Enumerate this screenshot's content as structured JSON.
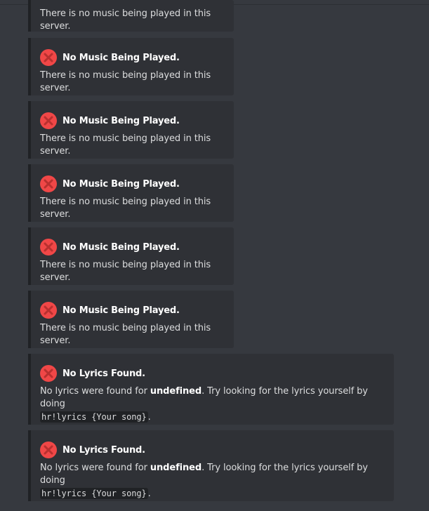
{
  "embeds": {
    "no_music": {
      "title": "No Music Being Played.",
      "description": "There is no music being played in this server."
    },
    "no_lyrics": {
      "title": "No Lyrics Found.",
      "description_before": "No lyrics were found for ",
      "description_bold": "undefined",
      "description_after": ". Try looking for the lyrics yourself by doing",
      "code": "hr!lyrics {Your song}",
      "description_end": "."
    }
  },
  "icon": "red-cross-mark-icon",
  "colors": {
    "background": "#36393f",
    "embed_background": "#2f3136",
    "icon_red": "#f04747"
  }
}
